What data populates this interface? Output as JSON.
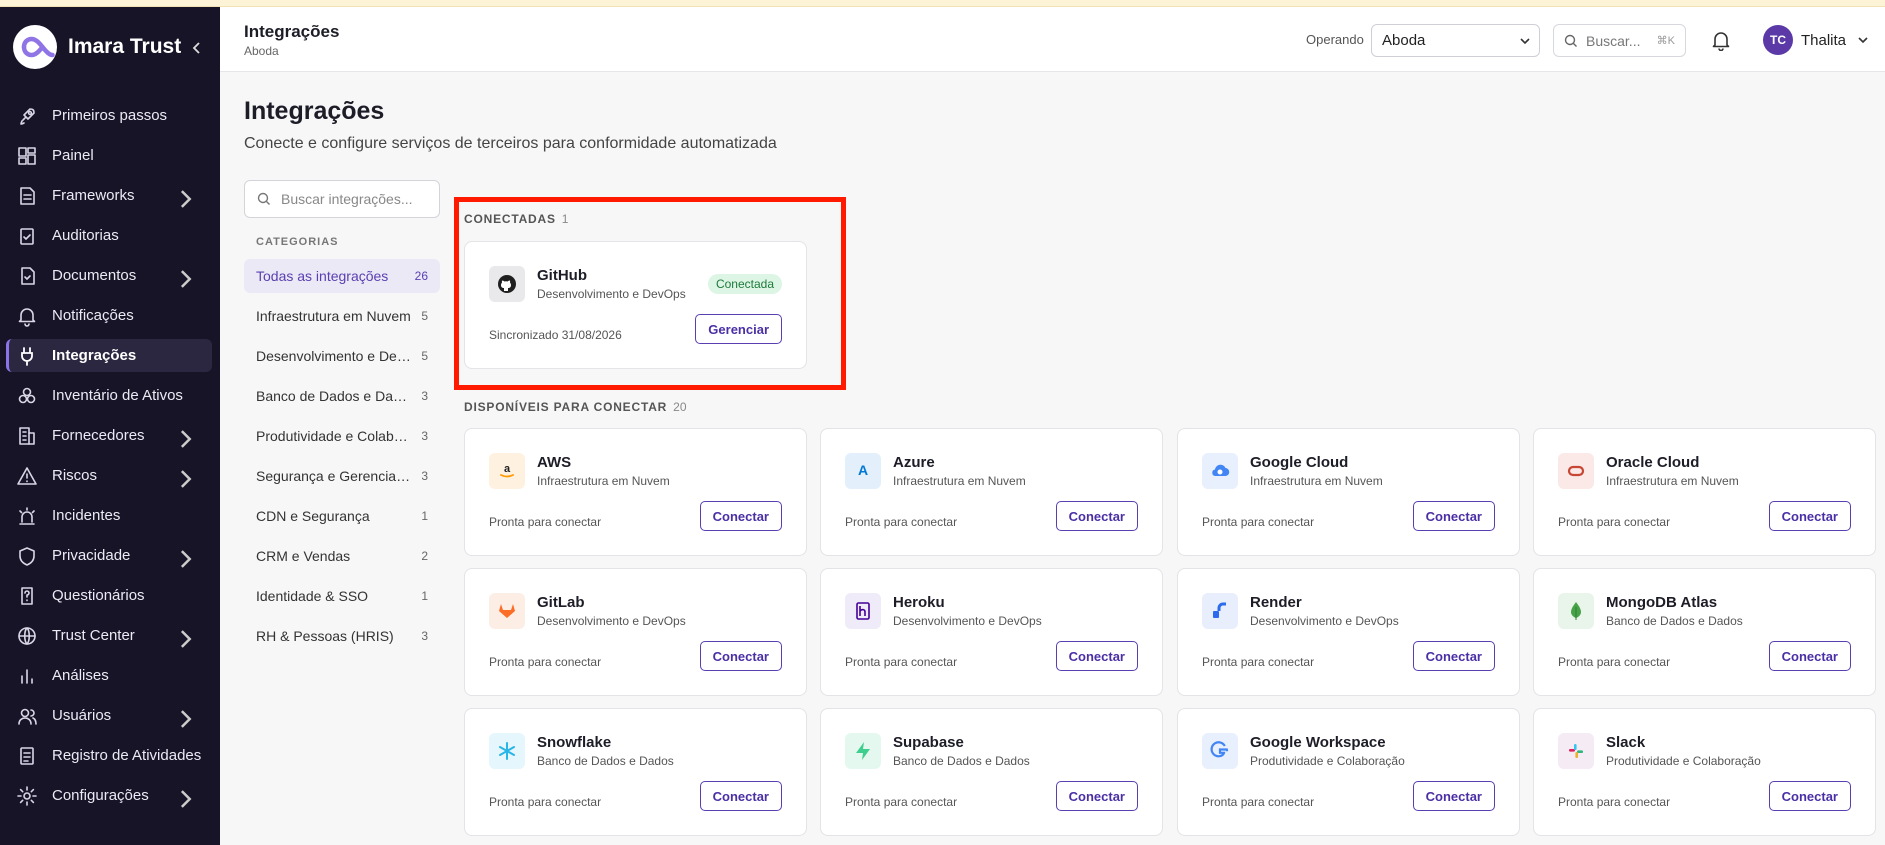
{
  "app": {
    "name": "Imara Trust"
  },
  "sidebar": {
    "items": [
      {
        "label": "Primeiros passos",
        "icon": "rocket-icon",
        "chevron": false
      },
      {
        "label": "Painel",
        "icon": "dashboard-icon",
        "chevron": false
      },
      {
        "label": "Frameworks",
        "icon": "document-icon",
        "chevron": true
      },
      {
        "label": "Auditorias",
        "icon": "clipboard-check-icon",
        "chevron": false
      },
      {
        "label": "Documentos",
        "icon": "file-icon",
        "chevron": true
      },
      {
        "label": "Notificações",
        "icon": "bell-icon",
        "chevron": false
      },
      {
        "label": "Integrações",
        "icon": "plug-icon",
        "chevron": false,
        "active": true
      },
      {
        "label": "Inventário de Ativos",
        "icon": "boxes-icon",
        "chevron": false
      },
      {
        "label": "Fornecedores",
        "icon": "building-icon",
        "chevron": true
      },
      {
        "label": "Riscos",
        "icon": "warning-icon",
        "chevron": true
      },
      {
        "label": "Incidentes",
        "icon": "siren-icon",
        "chevron": false
      },
      {
        "label": "Privacidade",
        "icon": "shield-icon",
        "chevron": true
      },
      {
        "label": "Questionários",
        "icon": "questionnaire-icon",
        "chevron": false
      },
      {
        "label": "Trust Center",
        "icon": "globe-icon",
        "chevron": true
      },
      {
        "label": "Análises",
        "icon": "bar-chart-icon",
        "chevron": false
      },
      {
        "label": "Usuários",
        "icon": "users-icon",
        "chevron": true
      },
      {
        "label": "Registro de Atividades",
        "icon": "log-icon",
        "chevron": false
      },
      {
        "label": "Configurações",
        "icon": "gear-icon",
        "chevron": true
      }
    ]
  },
  "header": {
    "title": "Integrações",
    "subtitle": "Aboda",
    "operating_label": "Operando",
    "operating_value": "Aboda",
    "search_placeholder": "Buscar...",
    "search_shortcut": "⌘K",
    "user_initials": "TC",
    "user_name": "Thalita"
  },
  "page": {
    "title": "Integrações",
    "subtitle": "Conecte e configure serviços de terceiros para conformidade automatizada",
    "search_placeholder": "Buscar integrações...",
    "categories_heading": "CATEGORIAS"
  },
  "categories": [
    {
      "label": "Todas as integrações",
      "count": "26",
      "active": true
    },
    {
      "label": "Infraestrutura em Nuvem",
      "count": "5"
    },
    {
      "label": "Desenvolvimento e DevOps",
      "count": "5"
    },
    {
      "label": "Banco de Dados e Dados",
      "count": "3"
    },
    {
      "label": "Produtividade e Colaboração",
      "count": "3"
    },
    {
      "label": "Segurança e Gerenciamento",
      "count": "3"
    },
    {
      "label": "CDN e Segurança",
      "count": "1"
    },
    {
      "label": "CRM e Vendas",
      "count": "2"
    },
    {
      "label": "Identidade & SSO",
      "count": "1"
    },
    {
      "label": "RH & Pessoas (HRIS)",
      "count": "3"
    }
  ],
  "connected": {
    "heading": "CONECTADAS",
    "count": "1",
    "cards": [
      {
        "name": "GitHub",
        "category": "Desenvolvimento e DevOps",
        "badge": "Conectada",
        "status": "Sincronizado 31/08/2026",
        "button": "Gerenciar",
        "icon": "github-icon"
      }
    ]
  },
  "available": {
    "heading": "DISPONÍVEIS PARA CONECTAR",
    "count": "20",
    "cards": [
      {
        "name": "AWS",
        "category": "Infraestrutura em Nuvem",
        "status": "Pronta para conectar",
        "button": "Conectar",
        "icon": "aws-icon",
        "color": "#ff9900"
      },
      {
        "name": "Azure",
        "category": "Infraestrutura em Nuvem",
        "status": "Pronta para conectar",
        "button": "Conectar",
        "icon": "azure-icon",
        "color": "#0078d4"
      },
      {
        "name": "Google Cloud",
        "category": "Infraestrutura em Nuvem",
        "status": "Pronta para conectar",
        "button": "Conectar",
        "icon": "google-cloud-icon",
        "color": "#4285f4"
      },
      {
        "name": "Oracle Cloud",
        "category": "Infraestrutura em Nuvem",
        "status": "Pronta para conectar",
        "button": "Conectar",
        "icon": "oracle-icon",
        "color": "#c74634"
      },
      {
        "name": "GitLab",
        "category": "Desenvolvimento e DevOps",
        "status": "Pronta para conectar",
        "button": "Conectar",
        "icon": "gitlab-icon",
        "color": "#fc6d26"
      },
      {
        "name": "Heroku",
        "category": "Desenvolvimento e DevOps",
        "status": "Pronta para conectar",
        "button": "Conectar",
        "icon": "heroku-icon",
        "color": "#430098"
      },
      {
        "name": "Render",
        "category": "Desenvolvimento e DevOps",
        "status": "Pronta para conectar",
        "button": "Conectar",
        "icon": "render-icon",
        "color": "#2c6bed"
      },
      {
        "name": "MongoDB Atlas",
        "category": "Banco de Dados e Dados",
        "status": "Pronta para conectar",
        "button": "Conectar",
        "icon": "mongodb-icon",
        "color": "#47a248"
      },
      {
        "name": "Snowflake",
        "category": "Banco de Dados e Dados",
        "status": "Pronta para conectar",
        "button": "Conectar",
        "icon": "snowflake-icon",
        "color": "#29b5e8"
      },
      {
        "name": "Supabase",
        "category": "Banco de Dados e Dados",
        "status": "Pronta para conectar",
        "button": "Conectar",
        "icon": "supabase-icon",
        "color": "#3ecf8e"
      },
      {
        "name": "Google Workspace",
        "category": "Produtividade e Colaboração",
        "status": "Pronta para conectar",
        "button": "Conectar",
        "icon": "google-icon",
        "color": "#4285f4"
      },
      {
        "name": "Slack",
        "category": "Produtividade e Colaboração",
        "status": "Pronta para conectar",
        "button": "Conectar",
        "icon": "slack-icon",
        "color": "#611f69"
      }
    ]
  }
}
